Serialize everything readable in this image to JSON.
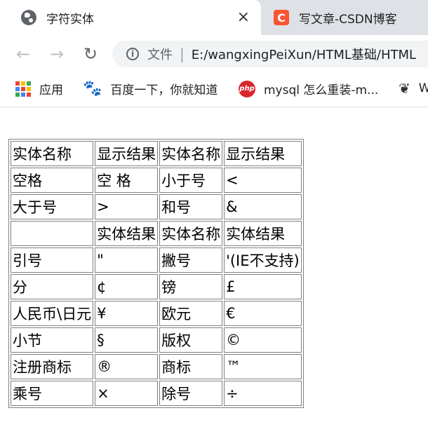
{
  "tabs": [
    {
      "title": "字符实体",
      "icon": "globe-icon",
      "active": true,
      "close": "×"
    },
    {
      "title": "写文章-CSDN博客",
      "icon": "csdn-icon",
      "icon_text": "C",
      "active": false
    }
  ],
  "toolbar": {
    "back": "←",
    "forward": "→",
    "reload": "↻",
    "info": "i",
    "scheme_label": "文件",
    "separator": "|",
    "url": "E:/wangxingPeiXun/HTML基础/HTML"
  },
  "bookmarks": [
    {
      "label": "应用",
      "icon": "apps-grid-icon"
    },
    {
      "label": "百度一下，你就知道",
      "icon": "baidu-paw-icon"
    },
    {
      "label": "mysql 怎么重装-m...",
      "icon": "php-icon",
      "icon_text": "php"
    },
    {
      "label": "W",
      "icon": "leaf-icon"
    }
  ],
  "colors": {
    "tabstrip_bg": "#dee1e6",
    "omnibox_bg": "#f1f3f4",
    "csdn_brand": "#fc5531",
    "baidu_blue": "#2932e1",
    "php_red": "#d9262c"
  },
  "table": {
    "rows": [
      [
        "实体名称",
        "显示结果",
        "实体名称",
        "显示结果"
      ],
      [
        "空格",
        "空 格",
        "小于号",
        "<"
      ],
      [
        "大于号",
        ">",
        "和号",
        "&"
      ],
      [
        "",
        "实体结果",
        "实体名称",
        "实体结果"
      ],
      [
        "引号",
        "\"",
        "撇号",
        "'(IE不支持)"
      ],
      [
        "分",
        "¢",
        "镑",
        "£"
      ],
      [
        "人民币\\日元",
        "¥",
        "欧元",
        "€"
      ],
      [
        "小节",
        "§",
        "版权",
        "©"
      ],
      [
        "注册商标",
        "®",
        "商标",
        "™"
      ],
      [
        "乘号",
        "×",
        "除号",
        "÷"
      ]
    ]
  }
}
